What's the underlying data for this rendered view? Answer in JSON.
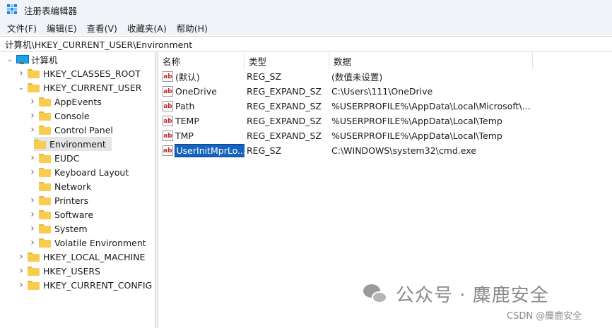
{
  "window": {
    "title": "注册表编辑器"
  },
  "menu": [
    "文件(F)",
    "编辑(E)",
    "查看(V)",
    "收藏夹(A)",
    "帮助(H)"
  ],
  "address": "计算机\\HKEY_CURRENT_USER\\Environment",
  "tree": {
    "root": "计算机",
    "items": [
      {
        "label": "HKEY_CLASSES_ROOT",
        "level": 1,
        "expanded": false
      },
      {
        "label": "HKEY_CURRENT_USER",
        "level": 1,
        "expanded": true
      },
      {
        "label": "AppEvents",
        "level": 2,
        "expanded": false
      },
      {
        "label": "Console",
        "level": 2,
        "expanded": false
      },
      {
        "label": "Control Panel",
        "level": 2,
        "expanded": false
      },
      {
        "label": "Environment",
        "level": 2,
        "selected": true,
        "leaf": true
      },
      {
        "label": "EUDC",
        "level": 2,
        "expanded": false
      },
      {
        "label": "Keyboard Layout",
        "level": 2,
        "expanded": false
      },
      {
        "label": "Network",
        "level": 2,
        "leaf": true
      },
      {
        "label": "Printers",
        "level": 2,
        "expanded": false
      },
      {
        "label": "Software",
        "level": 2,
        "expanded": false
      },
      {
        "label": "System",
        "level": 2,
        "expanded": false
      },
      {
        "label": "Volatile Environment",
        "level": 2,
        "expanded": false
      },
      {
        "label": "HKEY_LOCAL_MACHINE",
        "level": 1,
        "expanded": false
      },
      {
        "label": "HKEY_USERS",
        "level": 1,
        "expanded": false
      },
      {
        "label": "HKEY_CURRENT_CONFIG",
        "level": 1,
        "expanded": false
      }
    ]
  },
  "list": {
    "columns": [
      "名称",
      "类型",
      "数据"
    ],
    "rows": [
      {
        "name": "(默认)",
        "type": "REG_SZ",
        "data": "(数值未设置)"
      },
      {
        "name": "OneDrive",
        "type": "REG_EXPAND_SZ",
        "data": "C:\\Users\\111\\OneDrive"
      },
      {
        "name": "Path",
        "type": "REG_EXPAND_SZ",
        "data": "%USERPROFILE%\\AppData\\Local\\Microsoft\\..."
      },
      {
        "name": "TEMP",
        "type": "REG_EXPAND_SZ",
        "data": "%USERPROFILE%\\AppData\\Local\\Temp"
      },
      {
        "name": "TMP",
        "type": "REG_EXPAND_SZ",
        "data": "%USERPROFILE%\\AppData\\Local\\Temp"
      },
      {
        "name": "UserInitMprLo...",
        "type": "REG_SZ",
        "data": "C:\\WINDOWS\\system32\\cmd.exe",
        "editing": true
      }
    ]
  },
  "watermark": {
    "text": "公众号 · 麋鹿安全",
    "csdn": "CSDN @麋鹿安全"
  },
  "colors": {
    "accent": "#1565c0",
    "folder": "#f8cc4c",
    "selection": "#e5e5e5"
  }
}
